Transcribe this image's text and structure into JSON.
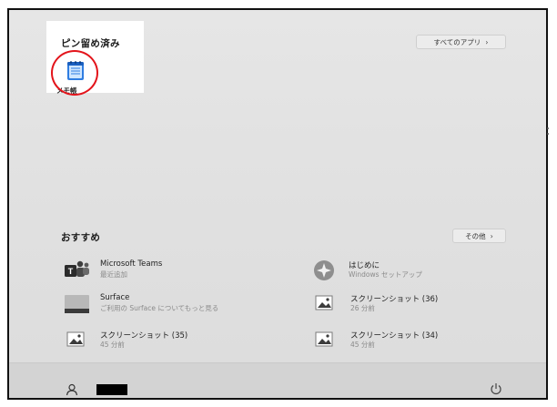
{
  "pinned": {
    "title": "ピン留め済み",
    "all_apps_label": "すべてのアプリ",
    "apps": [
      {
        "label": "メモ帳",
        "icon": "notepad-icon"
      }
    ]
  },
  "recommended": {
    "title": "おすすめ",
    "more_label": "その他",
    "items": [
      {
        "title": "Microsoft Teams",
        "subtitle": "最近追加",
        "icon": "teams-icon"
      },
      {
        "title": "はじめに",
        "subtitle": "Windows セットアップ",
        "icon": "get-started-icon"
      },
      {
        "title": "Surface",
        "subtitle": "ご利用の Surface についてもっと見る",
        "icon": "surface-icon"
      },
      {
        "title": "スクリーンショット (36)",
        "subtitle": "26 分前",
        "icon": "image-file-icon"
      },
      {
        "title": "スクリーンショット (35)",
        "subtitle": "45 分前",
        "icon": "image-file-icon"
      },
      {
        "title": "スクリーンショット (34)",
        "subtitle": "45 分前",
        "icon": "image-file-icon"
      }
    ]
  },
  "icons": {
    "chevron": "›",
    "user": "user-icon",
    "power": "power-icon"
  },
  "colors": {
    "highlight_ring": "#e3141b",
    "panel_bg": "#e3e3e3",
    "user_bar_bg": "#d3d3d3"
  }
}
